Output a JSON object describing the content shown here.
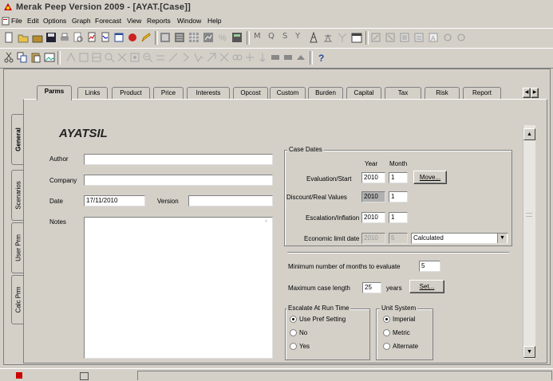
{
  "window": {
    "title": "Merak Peep Version 2009 - [AYAT.[Case]]"
  },
  "menu": [
    "File",
    "Edit",
    "Options",
    "Graph",
    "Forecast",
    "View",
    "Reports",
    "Window",
    "Help"
  ],
  "toolbar": {
    "letters": [
      "M",
      "Q",
      "S",
      "Y"
    ]
  },
  "tabs": [
    "Parms",
    "Links",
    "Product",
    "Price",
    "Interests",
    "Opcost",
    "Custom",
    "Burden",
    "Capital",
    "Tax",
    "Risk",
    "Report"
  ],
  "side_tabs": [
    "General",
    "Scenarios",
    "User Prm",
    "Calc Prm"
  ],
  "case": {
    "name": "AYATSIL"
  },
  "form": {
    "author_label": "Author",
    "company_label": "Company",
    "date_label": "Date",
    "date_value": "17/11/2010",
    "version_label": "Version",
    "notes_label": "Notes"
  },
  "case_dates": {
    "title": "Case Dates",
    "year_header": "Year",
    "month_header": "Month",
    "evaluation_label": "Evaluation/Start",
    "evaluation_year": "2010",
    "evaluation_month": "1",
    "move_button": "Move...",
    "discount_label": "Discount/Real Values",
    "discount_year": "2010",
    "discount_month": "1",
    "escalation_label": "Escalation/Inflation",
    "escalation_year": "2010",
    "escalation_month": "1",
    "economic_label": "Economic limit date",
    "economic_year": "2010",
    "economic_month": "5",
    "economic_method": "Calculated"
  },
  "limits": {
    "min_months_label": "Minimum number of months to evaluate",
    "min_months_value": "5",
    "max_length_label": "Maximum case length",
    "max_length_value": "25",
    "years_label": "years",
    "set_button": "Set..."
  },
  "escalate": {
    "title": "Escalate At Run Time",
    "options": [
      "Use Pref Setting",
      "No",
      "Yes"
    ],
    "selected": "Use Pref Setting"
  },
  "units": {
    "title": "Unit System",
    "options": [
      "Imperial",
      "Metric",
      "Alternate"
    ],
    "selected": "Imperial"
  },
  "colors": {
    "face": "#d4d0c8",
    "field": "#ffffff",
    "highlight_field": "#b0b0b0"
  }
}
